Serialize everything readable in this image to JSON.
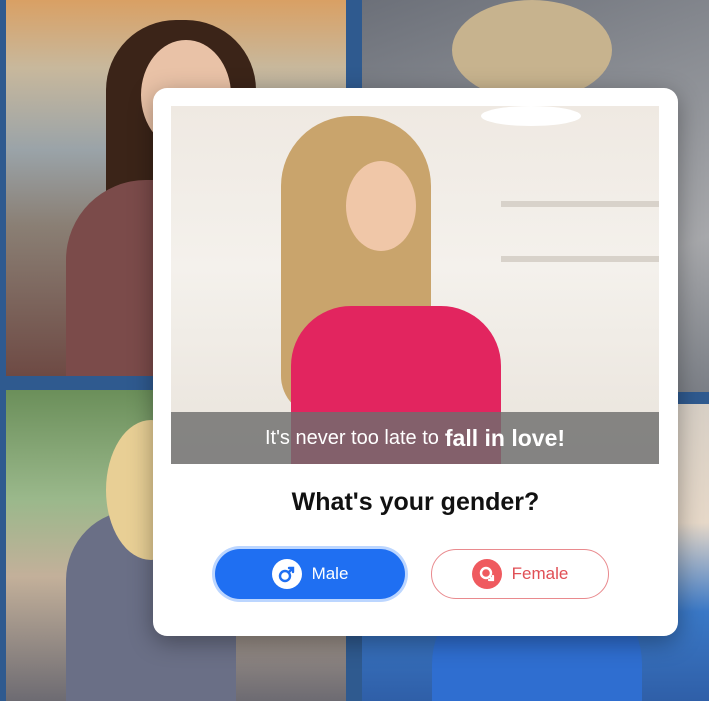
{
  "modal": {
    "banner": {
      "text": "It's never too late to",
      "emphasis": "fall in love!"
    },
    "question": "What's your gender?",
    "options": [
      {
        "label": "Male",
        "icon": "male-symbol-icon",
        "selected": true,
        "color": "#1f6ff2"
      },
      {
        "label": "Female",
        "icon": "female-symbol-icon",
        "selected": false,
        "color": "#e04f55"
      }
    ]
  }
}
